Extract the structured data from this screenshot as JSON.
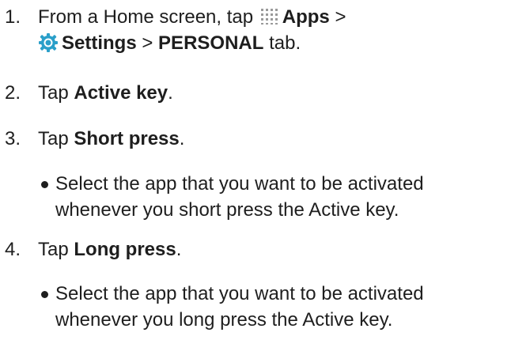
{
  "steps": [
    {
      "number": "1.",
      "line1_pre": "From a Home screen, tap",
      "apps_label": "Apps",
      "sep1": ">",
      "settings_label": "Settings",
      "sep2": ">",
      "personal_label": "PERSONAL",
      "line2_post": "tab.",
      "icons": [
        "apps-grid-icon",
        "settings-gear-icon"
      ]
    },
    {
      "number": "2.",
      "pre": "Tap",
      "bold": "Active key",
      "post": "."
    },
    {
      "number": "3.",
      "pre": "Tap",
      "bold": "Short press",
      "post": ".",
      "bullet": [
        "Select the app that you want to be activated",
        "whenever you short press the Active key."
      ]
    },
    {
      "number": "4.",
      "pre": "Tap",
      "bold": "Long press",
      "post": ".",
      "bullet": [
        "Select the app that you want to be activated",
        "whenever you long press the Active key."
      ]
    }
  ],
  "colors": {
    "text": "#1e1e1e",
    "settings_icon": "#2a9fc9"
  }
}
